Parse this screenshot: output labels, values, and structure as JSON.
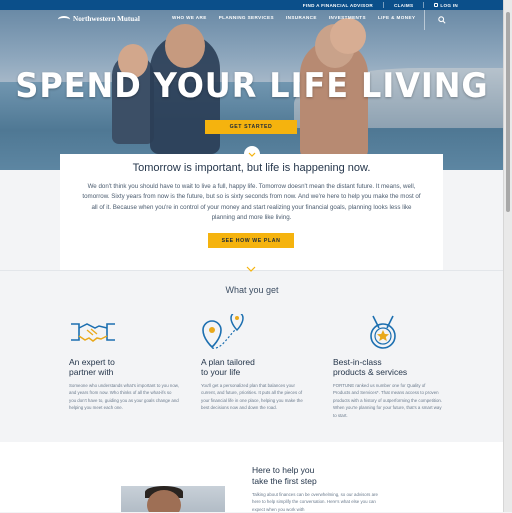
{
  "topbar": {
    "find_advisor": "FIND A FINANCIAL ADVISOR",
    "claims": "CLAIMS",
    "login": "LOG IN"
  },
  "logo": {
    "text": "Northwestern Mutual"
  },
  "nav": {
    "items": [
      "WHO WE ARE",
      "PLANNING SERVICES",
      "INSURANCE",
      "INVESTMENTS",
      "LIFE & MONEY"
    ]
  },
  "icons": {
    "search": "search-icon",
    "lock": "lock-icon",
    "handshake": "handshake-icon",
    "map_pins": "map-pin-icon",
    "medal": "medal-icon",
    "chevron": "chevron-down-icon"
  },
  "hero": {
    "headline": "SPEND YOUR LIFE LIVING",
    "cta": "GET STARTED"
  },
  "intro": {
    "title": "Tomorrow is important, but life is happening now.",
    "body": "We don't think you should have to wait to live a full, happy life. Tomorrow doesn't mean the distant future. It means, well, tomorrow. Sixty years from now is the future, but so is sixty seconds from now. And we're here to help you make the most of all of it. Because when you're in control of your money and start realizing your financial goals, planning looks less like planning and more like living.",
    "cta": "SEE HOW WE PLAN"
  },
  "what_you_get": {
    "heading": "What you get",
    "features": [
      {
        "title_line1": "An expert to",
        "title_line2": "partner with",
        "body": "Someone who understands what's important to you now, and years from now. Who thinks of all the what-ifs so you don't have to, guiding you as your goals change and helping you meet each one."
      },
      {
        "title_line1": "A plan tailored",
        "title_line2": "to your life",
        "body": "You'll get a personalized plan that balances your current, and future, priorities. It puts all the pieces of your financial life in one place, helping you make the best decisions now and down the road."
      },
      {
        "title_line1": "Best-in-class",
        "title_line2": "products & services",
        "body": "FORTUNE ranked us number one for Quality of Products and Services*. That means access to proven products with a history of outperforming the competition. When you're planning for your future, that's a smart way to start."
      }
    ]
  },
  "help": {
    "title_line1": "Here to help you",
    "title_line2": "take the first step",
    "body": "Talking about finances can be overwhelming, so our advisors are here to help simplify the conversation. Here's what else you can expect when you work with"
  },
  "colors": {
    "top_bar": "#0b4f8a",
    "accent_yellow": "#f5b30e",
    "icon_blue": "#1c6fb0",
    "icon_gold": "#e9a91b",
    "navy_text": "#25364b"
  }
}
